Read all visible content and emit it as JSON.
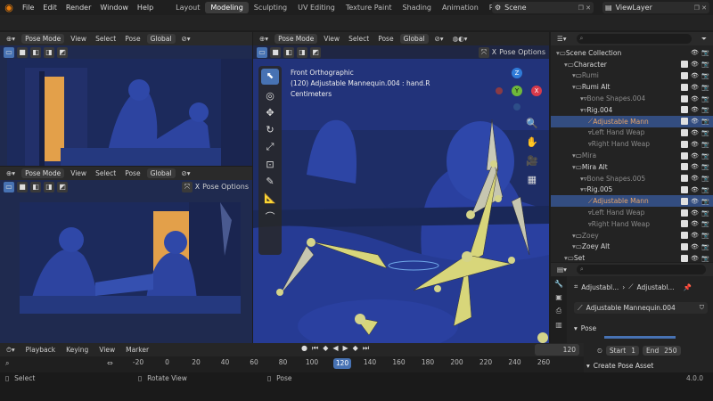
{
  "menu": [
    "File",
    "Edit",
    "Render",
    "Window",
    "Help"
  ],
  "workspaces": [
    {
      "label": "Layout",
      "active": false
    },
    {
      "label": "Modeling",
      "active": true
    },
    {
      "label": "Sculpting",
      "active": false
    },
    {
      "label": "UV Editing",
      "active": false
    },
    {
      "label": "Texture Paint",
      "active": false
    },
    {
      "label": "Shading",
      "active": false
    },
    {
      "label": "Animation",
      "active": false
    },
    {
      "label": "Rendering",
      "active": false
    }
  ],
  "scene_name": "Scene",
  "view_layer": "ViewLayer",
  "viewport_header": {
    "mode": "Pose Mode",
    "view": "View",
    "select": "Select",
    "pose": "Pose",
    "orientation": "Global",
    "pose_options": "Pose Options",
    "x_axis": "X"
  },
  "main_viewport": {
    "overlay_line1": "Front Orthographic",
    "overlay_line2": "(120) Adjustable Mannequin.004 : hand.R",
    "overlay_line3": "Centimeters",
    "gizmo_z": "Z",
    "gizmo_y": "Y",
    "gizmo_x": "X"
  },
  "outliner": {
    "rows": [
      {
        "label": "Scene Collection",
        "indent": 0,
        "style": "normal",
        "hl": false
      },
      {
        "label": "Character",
        "indent": 1,
        "style": "normal",
        "hl": false
      },
      {
        "label": "Rumi",
        "indent": 2,
        "style": "dim",
        "hl": false
      },
      {
        "label": "Rumi Alt",
        "indent": 2,
        "style": "normal",
        "hl": false
      },
      {
        "label": "Bone Shapes.004",
        "indent": 3,
        "style": "dim",
        "hl": false
      },
      {
        "label": "Rig.004",
        "indent": 3,
        "style": "normal",
        "hl": false
      },
      {
        "label": "Adjustable Mann",
        "indent": 4,
        "style": "orange",
        "hl": true
      },
      {
        "label": "Left Hand Weap",
        "indent": 4,
        "style": "dim",
        "hl": false
      },
      {
        "label": "Right Hand Weap",
        "indent": 4,
        "style": "dim",
        "hl": false
      },
      {
        "label": "Mira",
        "indent": 2,
        "style": "dim",
        "hl": false
      },
      {
        "label": "Mira Alt",
        "indent": 2,
        "style": "normal",
        "hl": false
      },
      {
        "label": "Bone Shapes.005",
        "indent": 3,
        "style": "dim",
        "hl": false
      },
      {
        "label": "Rig.005",
        "indent": 3,
        "style": "normal",
        "hl": false
      },
      {
        "label": "Adjustable Mann",
        "indent": 4,
        "style": "orange",
        "hl": true
      },
      {
        "label": "Left Hand Weap",
        "indent": 4,
        "style": "dim",
        "hl": false
      },
      {
        "label": "Right Hand Weap",
        "indent": 4,
        "style": "dim",
        "hl": false
      },
      {
        "label": "Zoey",
        "indent": 2,
        "style": "dim",
        "hl": false
      },
      {
        "label": "Zoey Alt",
        "indent": 2,
        "style": "normal",
        "hl": false
      },
      {
        "label": "Set",
        "indent": 1,
        "style": "normal",
        "hl": false
      }
    ]
  },
  "properties": {
    "breadcrumb1": "Adjustabl...",
    "breadcrumb2": "Adjustabl...",
    "object_name": "Adjustable Mannequin.004",
    "section": "Pose",
    "create_pose_asset": "Create Pose Asset"
  },
  "timeline": {
    "playback": "Playback",
    "keying": "Keying",
    "view": "View",
    "marker": "Marker",
    "current_frame": "120",
    "start_label": "Start",
    "start": "1",
    "end_label": "End",
    "end": "250",
    "ticks": [
      "-20",
      "0",
      "20",
      "40",
      "60",
      "80",
      "100",
      "120",
      "140",
      "160",
      "180",
      "200",
      "220",
      "240",
      "260"
    ]
  },
  "status": {
    "select": "Select",
    "rotate_view": "Rotate View",
    "pose": "Pose",
    "version": "4.0.0"
  },
  "colors": {
    "accent_blue": "#4772b3",
    "bone_yellow": "#d8d67a",
    "scene_blue": "#2a3f8a",
    "orange_light": "#e8a24a"
  }
}
